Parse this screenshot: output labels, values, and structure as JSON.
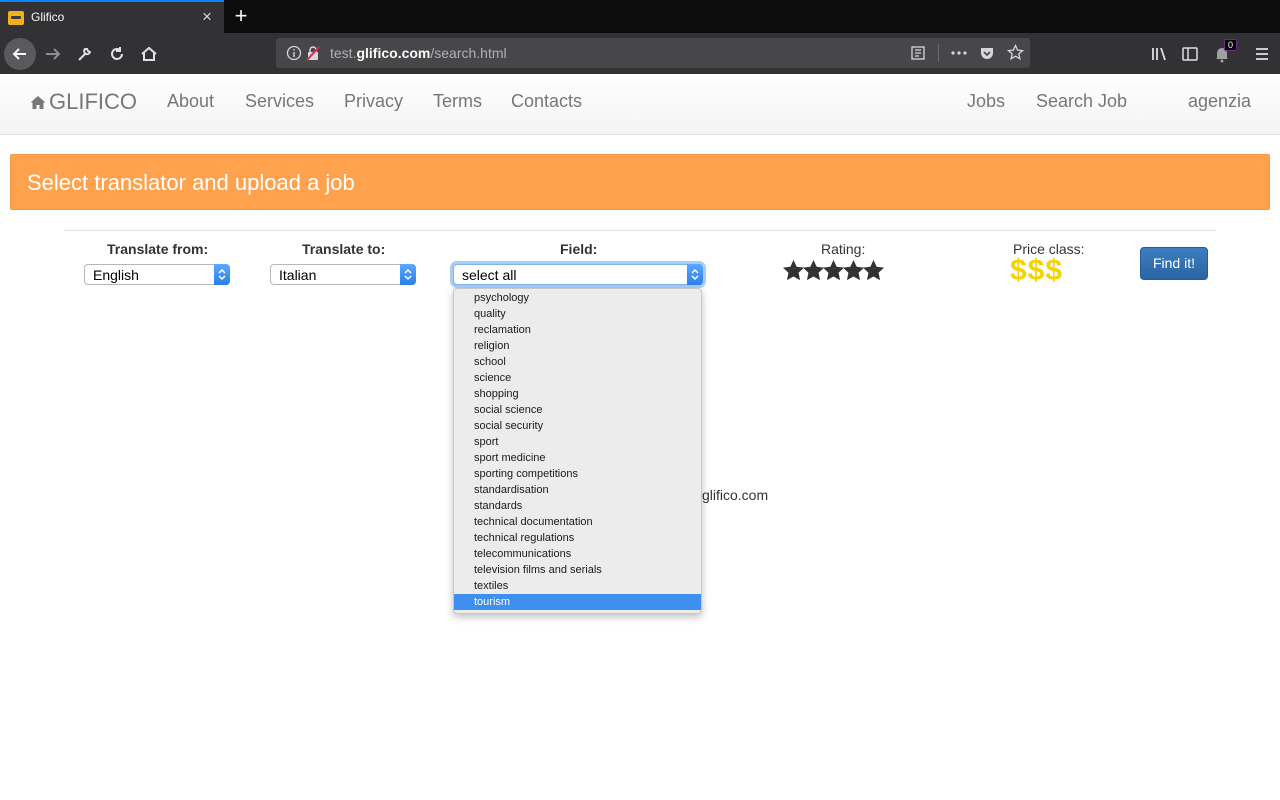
{
  "browser": {
    "tab_title": "Glifico",
    "url_prefix": "test.",
    "url_domain": "glifico.com",
    "url_path": "/search.html",
    "notification_count": "0"
  },
  "site_nav": {
    "brand": "GLIFICO",
    "left_links": [
      "About",
      "Services",
      "Privacy",
      "Terms",
      "Contacts"
    ],
    "right_links": [
      "Jobs",
      "Search Job",
      "agenzia"
    ]
  },
  "banner": {
    "title": "Select translator and upload a job"
  },
  "form": {
    "from_label": "Translate from:",
    "from_value": "English",
    "to_label": "Translate to:",
    "to_value": "Italian",
    "field_label": "Field:",
    "field_value": "select all",
    "rating_label": "Rating:",
    "rating_stars": 5,
    "price_label": "Price class:",
    "price_value": "$$$",
    "find_button": "Find it!"
  },
  "field_options": [
    "psychology",
    "quality",
    "reclamation",
    "religion",
    "school",
    "science",
    "shopping",
    "social science",
    "social security",
    "sport",
    "sport medicine",
    "sporting competitions",
    "standardisation",
    "standards",
    "technical documentation",
    "technical regulations",
    "telecommunications",
    "television films and serials",
    "textiles",
    "tourism"
  ],
  "field_selected": "tourism",
  "footer_partial": "glifico.com",
  "colors": {
    "banner": "#ffa24d",
    "star": "#333333",
    "price": "#f5d300",
    "button": "#337ab7",
    "selected_option": "#3f8ff0"
  }
}
